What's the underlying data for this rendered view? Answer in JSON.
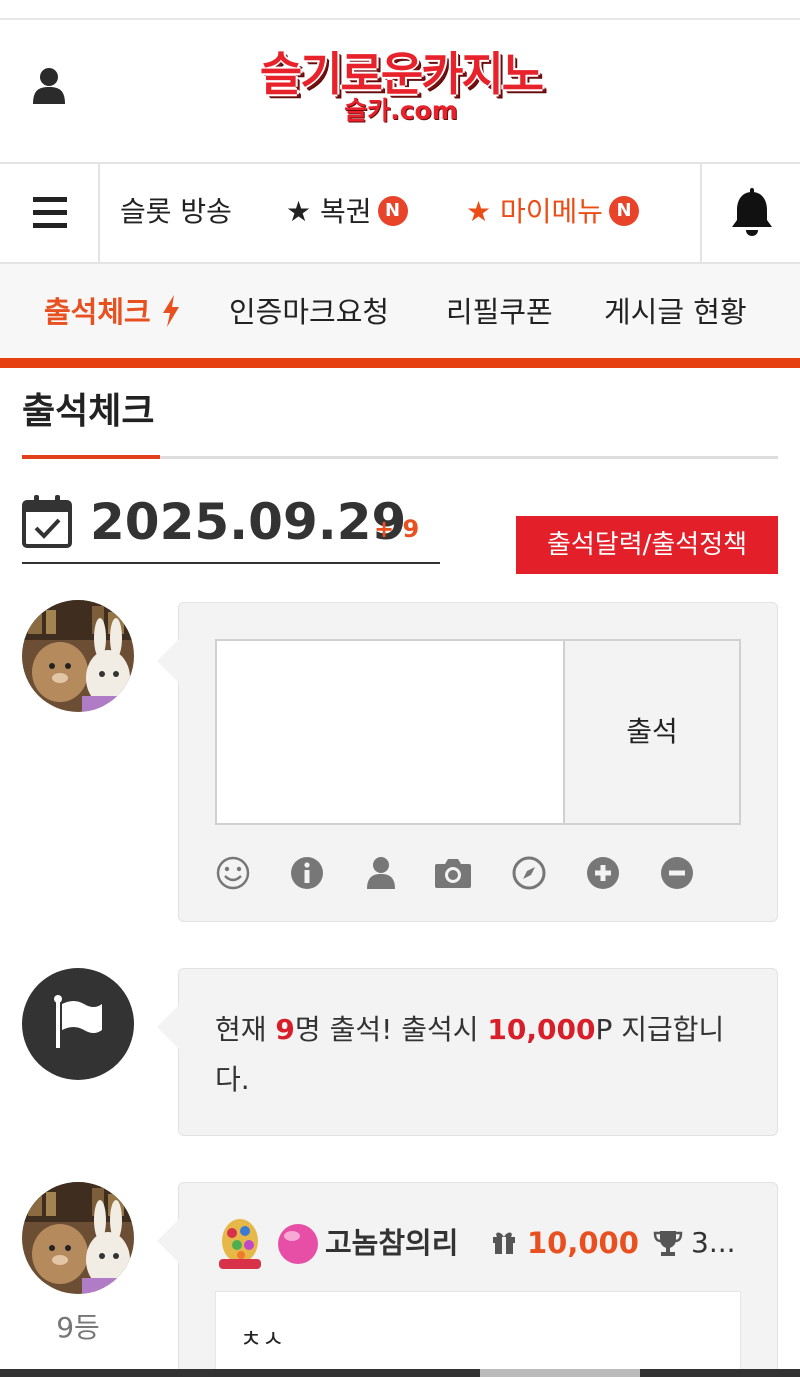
{
  "header": {
    "logo_main": "슬기로운카지노",
    "logo_sub": "슬카.com"
  },
  "nav_primary": {
    "items": [
      {
        "label": "슬롯 방송",
        "badge": ""
      },
      {
        "label": "★ 복권",
        "badge": "N"
      },
      {
        "label": "★ 마이메뉴",
        "badge": "N"
      }
    ]
  },
  "nav_secondary": {
    "items": [
      {
        "label": "출석체크",
        "active": true
      },
      {
        "label": "인증마크요청"
      },
      {
        "label": "리필쿠폰"
      },
      {
        "label": "게시글 현황"
      }
    ]
  },
  "page": {
    "title": "출석체크",
    "date": "2025.09.29",
    "date_count": "+ 9",
    "policy_button": "출석달력/출석정책"
  },
  "attend_form": {
    "textarea_value": "",
    "submit_label": "출석",
    "tools": [
      "smile-icon",
      "info-icon",
      "user-icon",
      "camera-icon",
      "compass-icon",
      "plus-circle-icon",
      "minus-circle-icon"
    ]
  },
  "notice": {
    "part1": "현재 ",
    "count": "9",
    "part2": "명 출석! 출석시 ",
    "points": "10,000",
    "part3": "P 지급합니다."
  },
  "entries": [
    {
      "rank": "9등",
      "nickname": "고놈참의리",
      "points": "10,000",
      "trophy": "3...",
      "comment": "ㅊㅅ"
    }
  ],
  "colors": {
    "accent_orange": "#e8501f",
    "brand_red": "#e32029",
    "bar_orange": "#e64011"
  }
}
